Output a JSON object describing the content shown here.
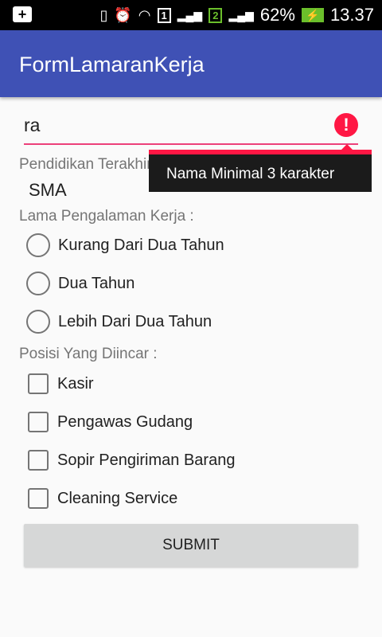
{
  "status": {
    "battery": "62%",
    "time": "13.37",
    "sim1": "1",
    "sim2": "2"
  },
  "app": {
    "title": "FormLamaranKerja"
  },
  "form": {
    "name_value": "ra",
    "error_text": "Nama Minimal 3 karakter",
    "error_color": "#ff1744",
    "education_label": "Pendidikan Terakhir :",
    "education_value": "SMA",
    "experience_label": "Lama Pengalaman Kerja :",
    "experience_options": [
      "Kurang Dari Dua Tahun",
      "Dua Tahun",
      "Lebih Dari Dua Tahun"
    ],
    "position_label": "Posisi Yang Diincar :",
    "position_options": [
      "Kasir",
      "Pengawas Gudang",
      "Sopir Pengiriman Barang",
      "Cleaning Service"
    ],
    "submit_label": "SUBMIT"
  },
  "colors": {
    "primary": "#3f51b5",
    "accent": "#ff4081"
  }
}
